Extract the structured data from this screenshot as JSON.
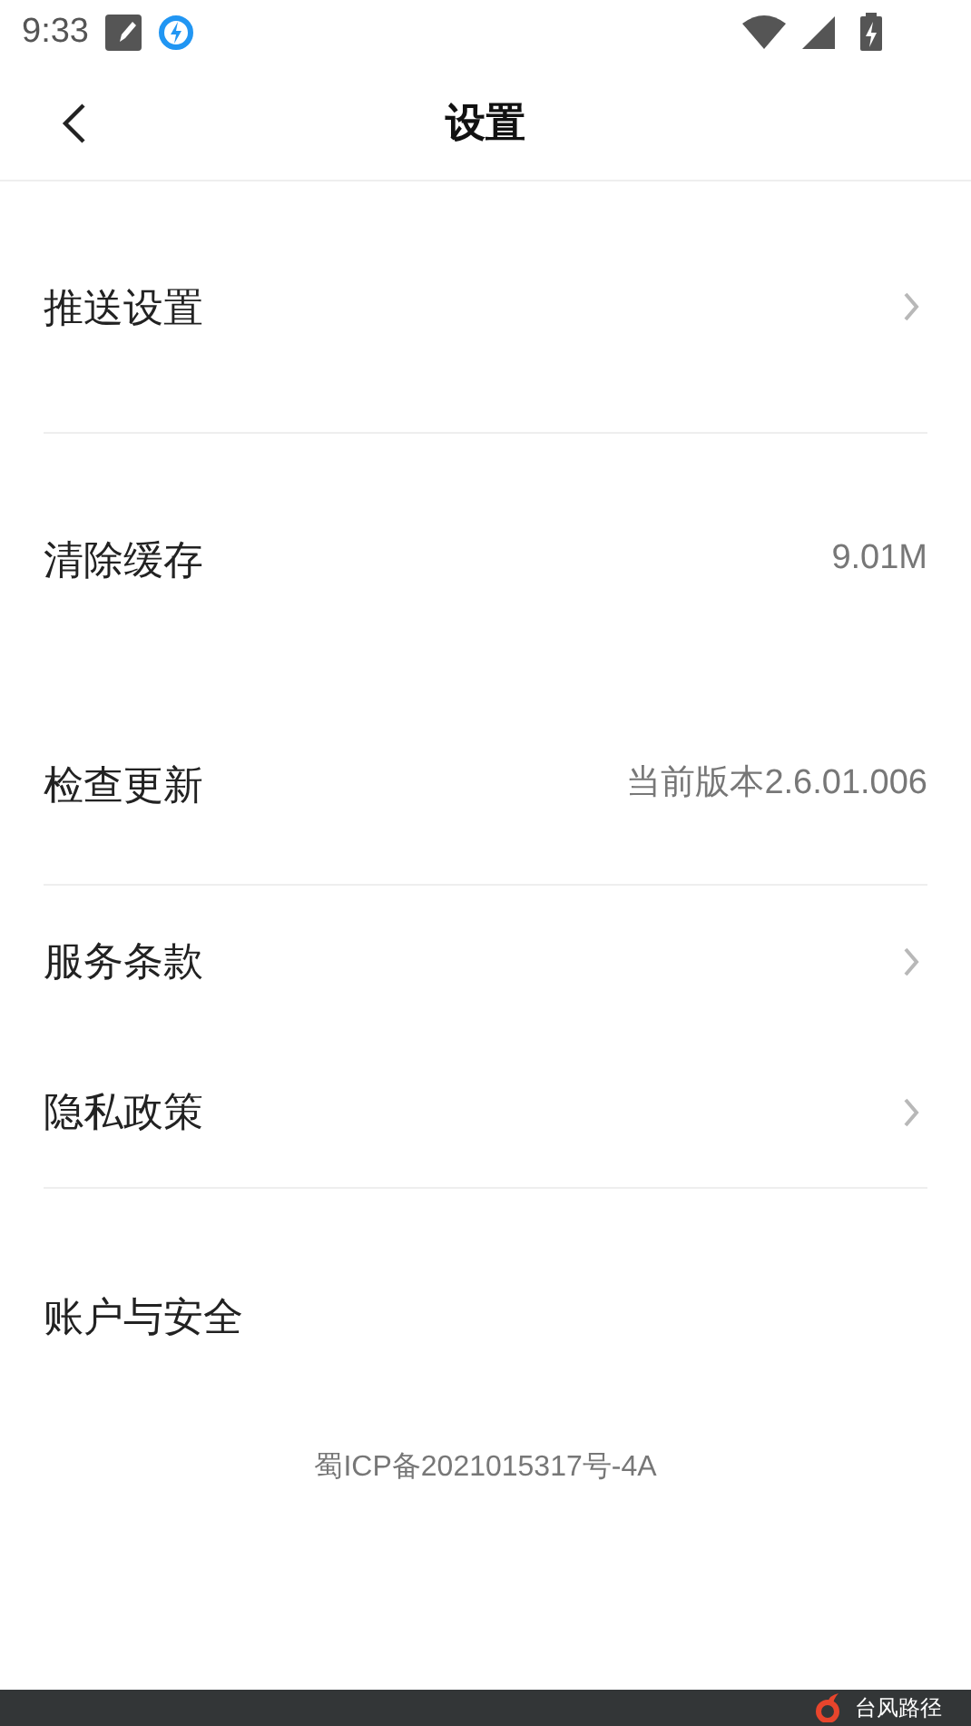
{
  "status_bar": {
    "time": "9:33"
  },
  "header": {
    "title": "设置"
  },
  "groups": [
    {
      "items": [
        {
          "label": "推送设置",
          "kind": "chevron"
        }
      ]
    },
    {
      "items": [
        {
          "label": "清除缓存",
          "kind": "value",
          "value": "9.01M"
        },
        {
          "label": "检查更新",
          "kind": "value",
          "value": "当前版本2.6.01.006"
        }
      ]
    },
    {
      "items": [
        {
          "label": "服务条款",
          "kind": "chevron"
        },
        {
          "label": "隐私政策",
          "kind": "chevron"
        }
      ]
    },
    {
      "items": [
        {
          "label": "账户与安全",
          "kind": "plain"
        }
      ]
    }
  ],
  "footer": {
    "icp": "蜀ICP备2021015317号-4A"
  },
  "bottom_banner": {
    "text": "台风路径"
  }
}
